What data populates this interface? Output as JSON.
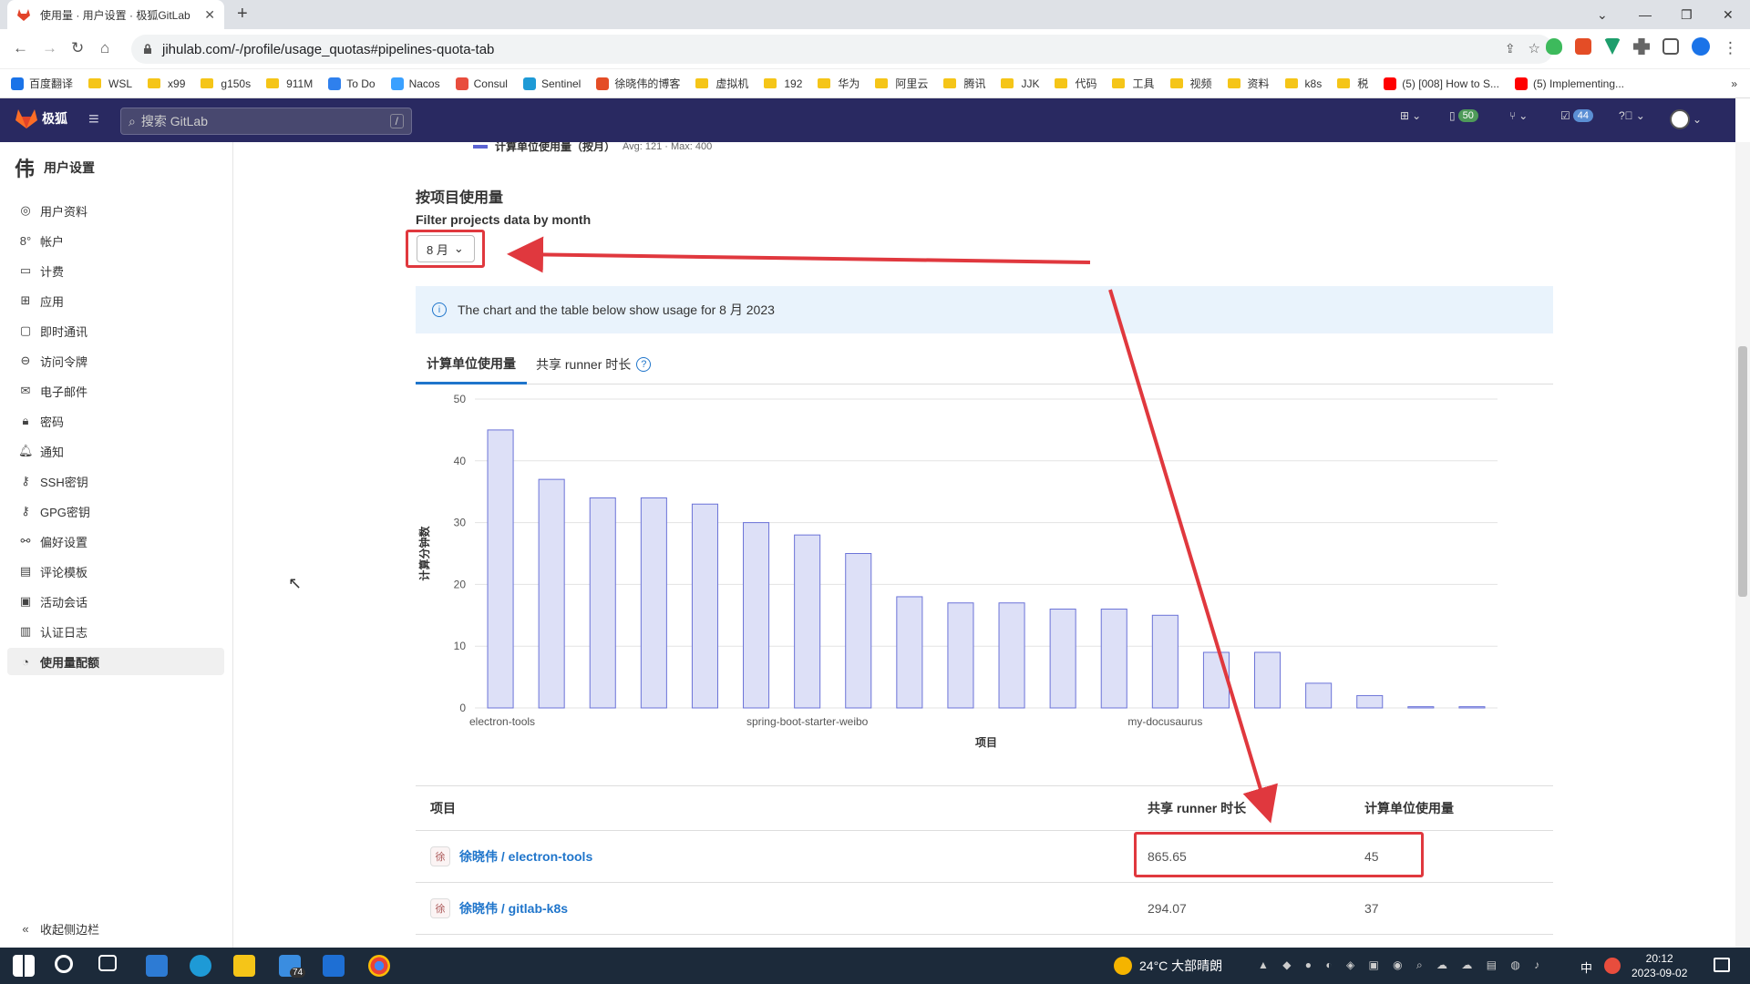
{
  "browser": {
    "tab_title": "使用量 · 用户设置 · 极狐GitLab",
    "url": "jihulab.com/-/profile/usage_quotas#pipelines-quota-tab",
    "bookmarks": [
      "百度翻译",
      "WSL",
      "x99",
      "g150s",
      "911M",
      "To Do",
      "Nacos",
      "Consul",
      "Sentinel",
      "徐晓伟的博客",
      "虚拟机",
      "192",
      "华为",
      "阿里云",
      "腾讯",
      "JJK",
      "代码",
      "工具",
      "视频",
      "资料",
      "k8s",
      "税",
      "(5) [008] How to S...",
      "(5) Implementing..."
    ]
  },
  "header": {
    "logo_text": "极狐",
    "search_placeholder": "搜索 GitLab",
    "search_kbd": "/",
    "issues_count": "50",
    "todo_count": "44"
  },
  "sidebar": {
    "title": "用户设置",
    "items": [
      {
        "label": "用户资料",
        "icon": "user-icon"
      },
      {
        "label": "帐户",
        "icon": "account-icon"
      },
      {
        "label": "计费",
        "icon": "billing-icon"
      },
      {
        "label": "应用",
        "icon": "apps-icon"
      },
      {
        "label": "即时通讯",
        "icon": "chat-icon"
      },
      {
        "label": "访问令牌",
        "icon": "token-icon"
      },
      {
        "label": "电子邮件",
        "icon": "mail-icon"
      },
      {
        "label": "密码",
        "icon": "lock-icon"
      },
      {
        "label": "通知",
        "icon": "bell-icon"
      },
      {
        "label": "SSH密钥",
        "icon": "key-icon"
      },
      {
        "label": "GPG密钥",
        "icon": "key-icon"
      },
      {
        "label": "偏好设置",
        "icon": "preferences-icon"
      },
      {
        "label": "评论模板",
        "icon": "comment-icon"
      },
      {
        "label": "活动会话",
        "icon": "monitor-icon"
      },
      {
        "label": "认证日志",
        "icon": "log-icon"
      },
      {
        "label": "使用量配额",
        "icon": "quota-icon",
        "active": true
      }
    ],
    "collapse_label": "收起侧边栏"
  },
  "content": {
    "legend_cut_label": "计算单位使用量（按月）",
    "legend_cut_stats": "Avg: 121 · Max: 400",
    "section_title": "按项目使用量",
    "filter_label": "Filter projects data by month",
    "month_selected": "8 月",
    "alert_text": "The chart and the table below show usage for 8 月 2023",
    "tabs": [
      "计算单位使用量",
      "共享 runner 时长"
    ],
    "table": {
      "headers": [
        "项目",
        "共享 runner 时长",
        "计算单位使用量"
      ],
      "rows": [
        {
          "avatar": "徐",
          "project": "徐晓伟 / electron-tools",
          "runner": "865.65",
          "units": "45"
        },
        {
          "avatar": "徐",
          "project": "徐晓伟 / gitlab-k8s",
          "runner": "294.07",
          "units": "37"
        }
      ]
    }
  },
  "chart_data": {
    "type": "bar",
    "categories": [
      "electron-tools",
      "",
      "",
      "",
      "",
      "",
      "spring-boot-starter-weibo",
      "",
      "",
      "",
      "",
      "",
      "",
      "my-docusaurus",
      "",
      "",
      "",
      "",
      "",
      ""
    ],
    "values": [
      45,
      37,
      34,
      34,
      33,
      30,
      28,
      25,
      18,
      17,
      17,
      16,
      16,
      15,
      9,
      9,
      4,
      2,
      0.2,
      0.2
    ],
    "xlabel": "项目",
    "ylabel": "计算分钟数",
    "ylim": [
      0,
      50
    ],
    "yticks": [
      0,
      10,
      20,
      30,
      40,
      50
    ],
    "grid": true,
    "color": "#dde0f7",
    "stroke": "#6b73d8"
  },
  "taskbar": {
    "weather": "24°C  大部晴朗",
    "time": "20:12",
    "date": "2023-09-02",
    "badge": "74",
    "ime": "中"
  },
  "colors": {
    "header_bg": "#292961",
    "accent": "#1f75cb",
    "highlight": "#e0383e"
  }
}
